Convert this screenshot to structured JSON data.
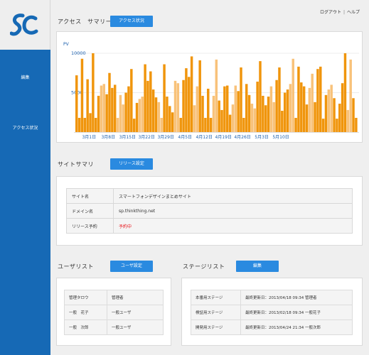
{
  "header": {
    "logout": "ログアウト",
    "separator": "|",
    "help": "ヘルプ"
  },
  "sidebar": {
    "items": [
      {
        "label": "編集"
      },
      {
        "label": "アクセス状況"
      }
    ]
  },
  "colors": {
    "sidebar": "#1669b5",
    "button": "#2a8ae0",
    "bar_dark": "#f0950c",
    "bar_light": "#f8c27a",
    "warning": "#e8161b"
  },
  "access": {
    "title": "アクセス　サマリー",
    "button": "アクセス状況",
    "chart_data": {
      "type": "bar",
      "ylabel": "PV",
      "y_ticks": [
        "10000",
        "5000"
      ],
      "ylim": [
        0,
        10000
      ],
      "x_tick_labels": [
        "3月1日",
        "3月8日",
        "3月15日",
        "3月22日",
        "3月29日",
        "4月5日",
        "4月12日",
        "4月19日",
        "4月26日",
        "5月3日",
        "5月10日"
      ],
      "series": [
        {
          "style": "weekday",
          "color": "#f0950c"
        },
        {
          "style": "weekend",
          "color": "#f8c27a"
        }
      ],
      "values": [
        7200,
        1800,
        9300,
        1800,
        6700,
        2400,
        10000,
        1800,
        4600,
        5900,
        6100,
        4800,
        7500,
        5600,
        6000,
        1800,
        4700,
        3500,
        5000,
        5800,
        8000,
        1700,
        3700,
        4200,
        4500,
        8600,
        6500,
        7700,
        5400,
        4400,
        3800,
        1800,
        8600,
        4500,
        3300,
        2500,
        6500,
        6200,
        1800,
        6600,
        8100,
        7000,
        9600,
        3400,
        5800,
        9100,
        4600,
        1800,
        5500,
        1800,
        4600,
        9200,
        4000,
        2800,
        5800,
        5900,
        2200,
        3500,
        5900,
        5200,
        8200,
        1800,
        6100,
        4700,
        3600,
        3000,
        6400,
        9000,
        4600,
        3400,
        4500,
        5800,
        3800,
        6600,
        8200,
        2700,
        5000,
        5400,
        6100,
        9300,
        1800,
        8300,
        6300,
        5800,
        3500,
        5600,
        7400,
        3800,
        8000,
        8300,
        1700,
        4700,
        5400,
        6000,
        4300,
        1700,
        3600,
        6200,
        10000,
        2800,
        9200,
        4300,
        1800
      ],
      "weekend": [
        false,
        false,
        false,
        false,
        false,
        false,
        false,
        false,
        false,
        true,
        true,
        false,
        false,
        false,
        false,
        true,
        true,
        true,
        false,
        false,
        false,
        false,
        false,
        true,
        true,
        false,
        false,
        false,
        false,
        false,
        true,
        true,
        false,
        false,
        false,
        false,
        true,
        true,
        false,
        false,
        false,
        false,
        false,
        true,
        true,
        false,
        false,
        false,
        false,
        false,
        true,
        true,
        false,
        false,
        false,
        false,
        false,
        true,
        true,
        false,
        false,
        false,
        false,
        false,
        true,
        true,
        false,
        false,
        false,
        false,
        false,
        true,
        true,
        false,
        false,
        false,
        false,
        false,
        true,
        true,
        false,
        false,
        false,
        false,
        false,
        true,
        true,
        false,
        false,
        false,
        false,
        false,
        true,
        true,
        false,
        false,
        false,
        false,
        false,
        true,
        true,
        false,
        false
      ]
    }
  },
  "site": {
    "title": "サイトサマリ",
    "button": "リリース設定",
    "rows": [
      {
        "label": "サイト名",
        "value": "スマートフォンデザインまとめサイト"
      },
      {
        "label": "ドメイン名",
        "value": "sp.thinkthing.net"
      },
      {
        "label": "リリース予約",
        "value": "予約中"
      }
    ]
  },
  "users": {
    "title": "ユーザリスト",
    "button": "ユーザ設定",
    "rows": [
      {
        "name": "管理タロウ",
        "role": "管理者"
      },
      {
        "name": "一般　花子",
        "role": "一般ユーザ"
      },
      {
        "name": "一般　次郎",
        "role": "一般ユーザ"
      }
    ]
  },
  "stages": {
    "title": "ステージリスト",
    "button": "編集",
    "rows": [
      {
        "name": "本番用ステージ",
        "info": "最終更新日：2013/04/18 09:34 管理者"
      },
      {
        "name": "検証用ステージ",
        "info": "最終更新日：2013/02/18 09:34 一般花子"
      },
      {
        "name": "開発用ステージ",
        "info": "最終更新日：2013/04/24 21:34 一般次郎"
      }
    ]
  }
}
